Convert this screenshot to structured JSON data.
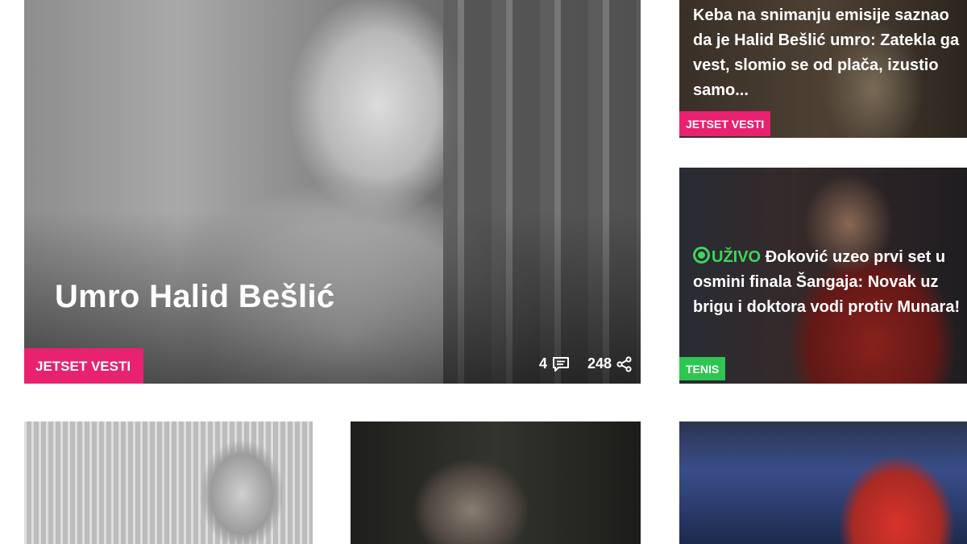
{
  "hero": {
    "title": "Umro Halid Bešlić",
    "category": "JETSET VESTI",
    "comments": "4",
    "shares": "248"
  },
  "side_articles": [
    {
      "title": "Keba na snimanju emisije saznao da je Halid Bešlić umro: Zatekla ga vest, slomio se od plača, izustio samo...",
      "category": "JETSET VESTI"
    },
    {
      "live_label": "UŽIVO",
      "title": "Đoković uzeo prvi set u osmini finala Šangaja: Novak uz brigu i doktora vodi protiv Munara!",
      "category": "TENIS"
    }
  ],
  "colors": {
    "tag_jetset": "#e8226f",
    "tag_tenis": "#2fc552",
    "live": "#3fd45c"
  },
  "icons": {
    "comments": "comment-icon",
    "share": "share-icon",
    "live": "live-dot-icon"
  }
}
